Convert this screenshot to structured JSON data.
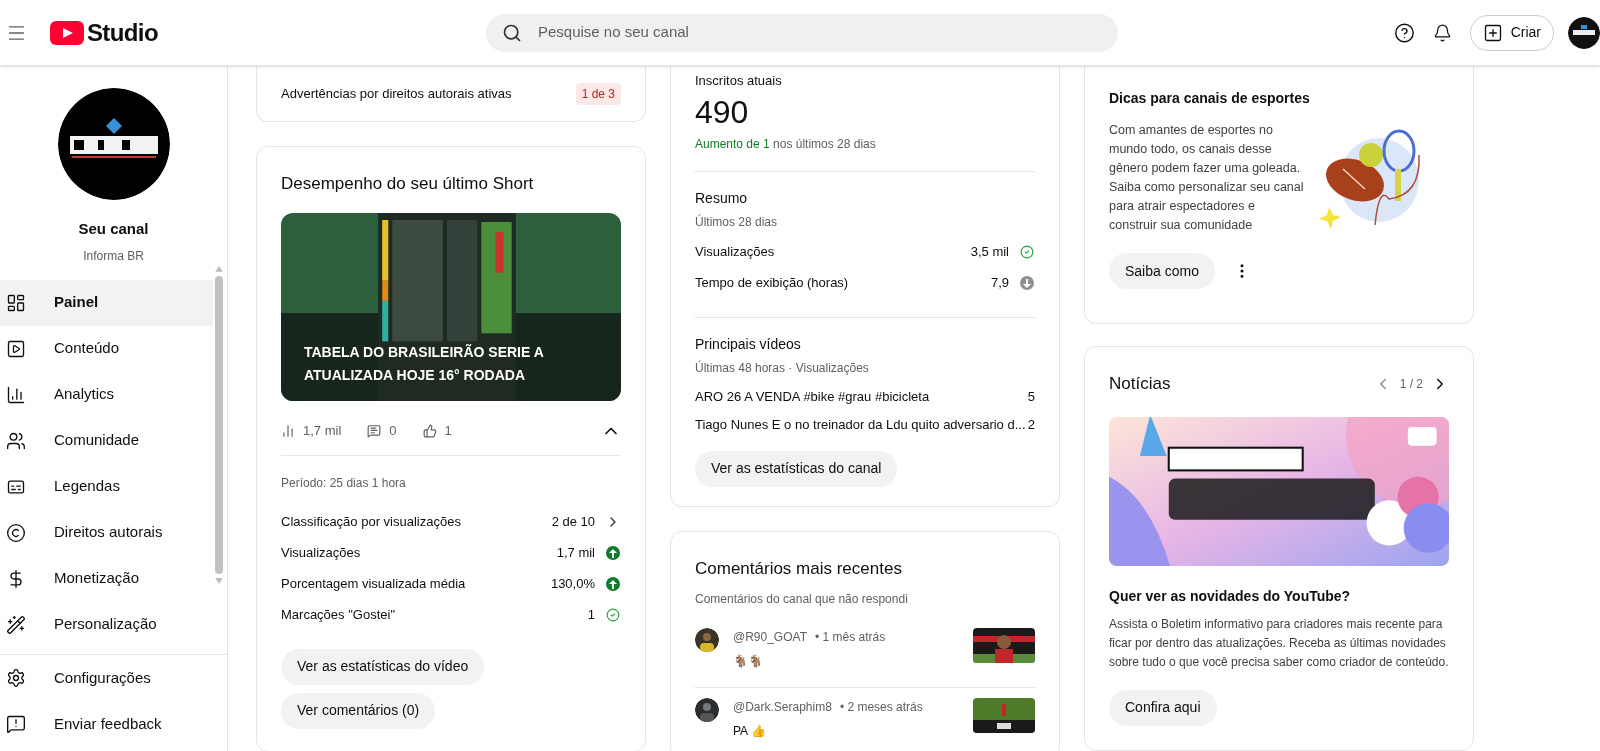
{
  "header": {
    "logo_text": "Studio",
    "search": {
      "placeholder": "Pesquise no seu canal"
    },
    "create_button": "Criar"
  },
  "sidebar": {
    "channel_label": "Seu canal",
    "channel_name": "Informa BR",
    "items": [
      {
        "label": "Painel",
        "kind": "dashboard",
        "selected": true
      },
      {
        "label": "Conteúdo",
        "kind": "content",
        "selected": false
      },
      {
        "label": "Analytics",
        "kind": "analytics",
        "selected": false
      },
      {
        "label": "Comunidade",
        "kind": "community",
        "selected": false
      },
      {
        "label": "Legendas",
        "kind": "subtitles",
        "selected": false
      },
      {
        "label": "Direitos autorais",
        "kind": "copyright",
        "selected": false
      },
      {
        "label": "Monetização",
        "kind": "money",
        "selected": false
      },
      {
        "label": "Personalização",
        "kind": "wand",
        "selected": false
      }
    ],
    "footer_items": [
      {
        "label": "Configurações",
        "kind": "settings"
      },
      {
        "label": "Enviar feedback",
        "kind": "feedback"
      }
    ]
  },
  "strikes_card": {
    "label": "Advertências por direitos autorais ativas",
    "badge": "1 de 3"
  },
  "short_card": {
    "title": "Desempenho do seu último Short",
    "thumbnail_title": "TABELA DO BRASILEIRÃO SERIE A ATUALIZADA HOJE 16° RODADA",
    "views": "1,7 mil",
    "comments": "0",
    "likes": "1",
    "expanded": true,
    "period": "Período: 25 dias 1 hora",
    "stats": [
      {
        "label": "Classificação por visualizações",
        "value": "2 de 10",
        "kind": "next"
      },
      {
        "label": "Visualizações",
        "value": "1,7 mil",
        "kind": "up"
      },
      {
        "label": "Porcentagem visualizada média",
        "value": "130,0%",
        "kind": "up"
      },
      {
        "label": "Marcações \"Gostei\"",
        "value": "1",
        "kind": "check"
      }
    ],
    "buttons": [
      "Ver as estatísticas do vídeo",
      "Ver comentários (0)"
    ]
  },
  "analytics_card": {
    "subscribers_label": "Inscritos atuais",
    "subscribers": "490",
    "change_highlight": "Aumento de 1",
    "change_rest": "nos últimos 28 dias",
    "summary_title": "Resumo",
    "summary_period": "Últimos 28 dias",
    "summary": [
      {
        "label": "Visualizações",
        "value": "3,5 mil",
        "kind": "check"
      },
      {
        "label": "Tempo de exibição (horas)",
        "value": "7,9",
        "kind": "down"
      }
    ],
    "top_videos_title": "Principais vídeos",
    "top_videos_period": "Últimas 48 horas · Visualizações",
    "top_videos": [
      {
        "title": "ARO 26 A VENDA #bike #grau #bicicleta",
        "views": "5"
      },
      {
        "title": "Tiago Nunes E o no treinador da Ldu quito adversario d...",
        "views": "2"
      }
    ],
    "button": "Ver as estatísticas do canal"
  },
  "comments_card": {
    "title": "Comentários mais recentes",
    "subtitle": "Comentários do canal que não respondi",
    "comments": [
      {
        "author": "@R90_GOAT",
        "time": "• 1 mês atrás",
        "text": "🐐🐐"
      },
      {
        "author": "@Dark.Seraphim8",
        "time": "• 2 meses atrás",
        "text": "PA 👍"
      }
    ]
  },
  "tips_card": {
    "title": "Dicas para canais de esportes",
    "body": "Com amantes de esportes no mundo todo, os canais desse gênero podem fazer uma goleada. Saiba como personalizar seu canal para atrair espectadores e construir sua comunidade",
    "button": "Saiba como"
  },
  "news_card": {
    "title": "Notícias",
    "pager": "1 / 2",
    "headline": "Quer ver as novidades do YouTube?",
    "body": "Assista o Boletim informativo para criadores mais recente para ficar por dentro das atualizações. Receba as últimas novidades sobre tudo o que você precisa saber como criador de conteúdo.",
    "button": "Confira aqui"
  }
}
